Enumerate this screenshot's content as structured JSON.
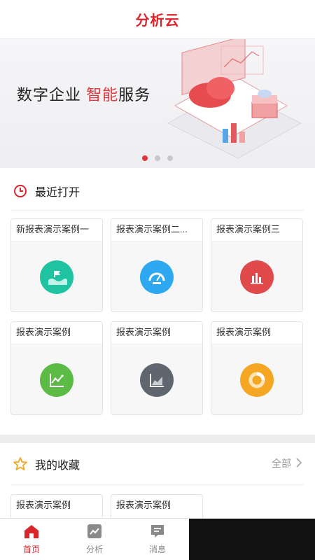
{
  "header": {
    "title": "分析云"
  },
  "banner": {
    "headline_prefix": "数字企业 ",
    "headline_accent": "智能",
    "headline_suffix": "服务",
    "slide_count": 3,
    "active_slide": 1
  },
  "recent": {
    "title": "最近打开",
    "cards": [
      {
        "title": "新报表演示案例一",
        "icon": "wave-flag-icon",
        "color": "#1fc3a2"
      },
      {
        "title": "报表演示案例二...",
        "icon": "gauge-icon",
        "color": "#2ea8f0"
      },
      {
        "title": "报表演示案例三",
        "icon": "bar-chart-icon",
        "color": "#e04a4a"
      },
      {
        "title": "报表演示案例",
        "icon": "line-chart-icon",
        "color": "#5bbb44"
      },
      {
        "title": "报表演示案例",
        "icon": "area-chart-icon",
        "color": "#5f6670"
      },
      {
        "title": "报表演示案例",
        "icon": "donut-chart-icon",
        "color": "#f5a623"
      }
    ]
  },
  "favorites": {
    "title": "我的收藏",
    "more_label": "全部",
    "cards": [
      {
        "title": "报表演示案例"
      },
      {
        "title": "报表演示案例"
      }
    ]
  },
  "tabbar": {
    "tabs": [
      {
        "label": "首页",
        "icon": "home-icon",
        "active": true
      },
      {
        "label": "分析",
        "icon": "analysis-icon",
        "active": false
      },
      {
        "label": "消息",
        "icon": "message-icon",
        "active": false
      }
    ]
  },
  "colors": {
    "brand_red": "#d9262c",
    "accent_red": "#e0383e"
  }
}
